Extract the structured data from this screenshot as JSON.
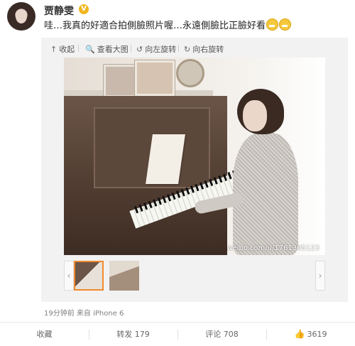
{
  "post": {
    "username": "贾静雯",
    "verified_badge": "V",
    "text": "哇…我真的好適合拍側臉照片喔…永遠側臉比正臉好看",
    "emojis": [
      "grinning-face-emoji",
      "grinning-face-emoji"
    ],
    "time": "19分钟前",
    "source": "来自 iPhone 6"
  },
  "media": {
    "toolbar": [
      {
        "icon": "collapse-up-icon",
        "glyph": "↑",
        "label": "收起"
      },
      {
        "icon": "magnifier-icon",
        "glyph": "🔍",
        "label": "查看大图"
      },
      {
        "icon": "rotate-left-icon",
        "glyph": "↺",
        "label": "向左旋转"
      },
      {
        "icon": "rotate-right-icon",
        "glyph": "↻",
        "label": "向右旋转"
      }
    ],
    "watermark": "weibo.com/u/1761305123",
    "thumbnail_count": 2,
    "selected_thumbnail": 1
  },
  "actions": {
    "favorite": "收藏",
    "repost": "转发 179",
    "comment": "评论 708",
    "like": "3619"
  },
  "colors": {
    "accent_selected": "#f28a2c",
    "verified": "#f2b61f"
  }
}
